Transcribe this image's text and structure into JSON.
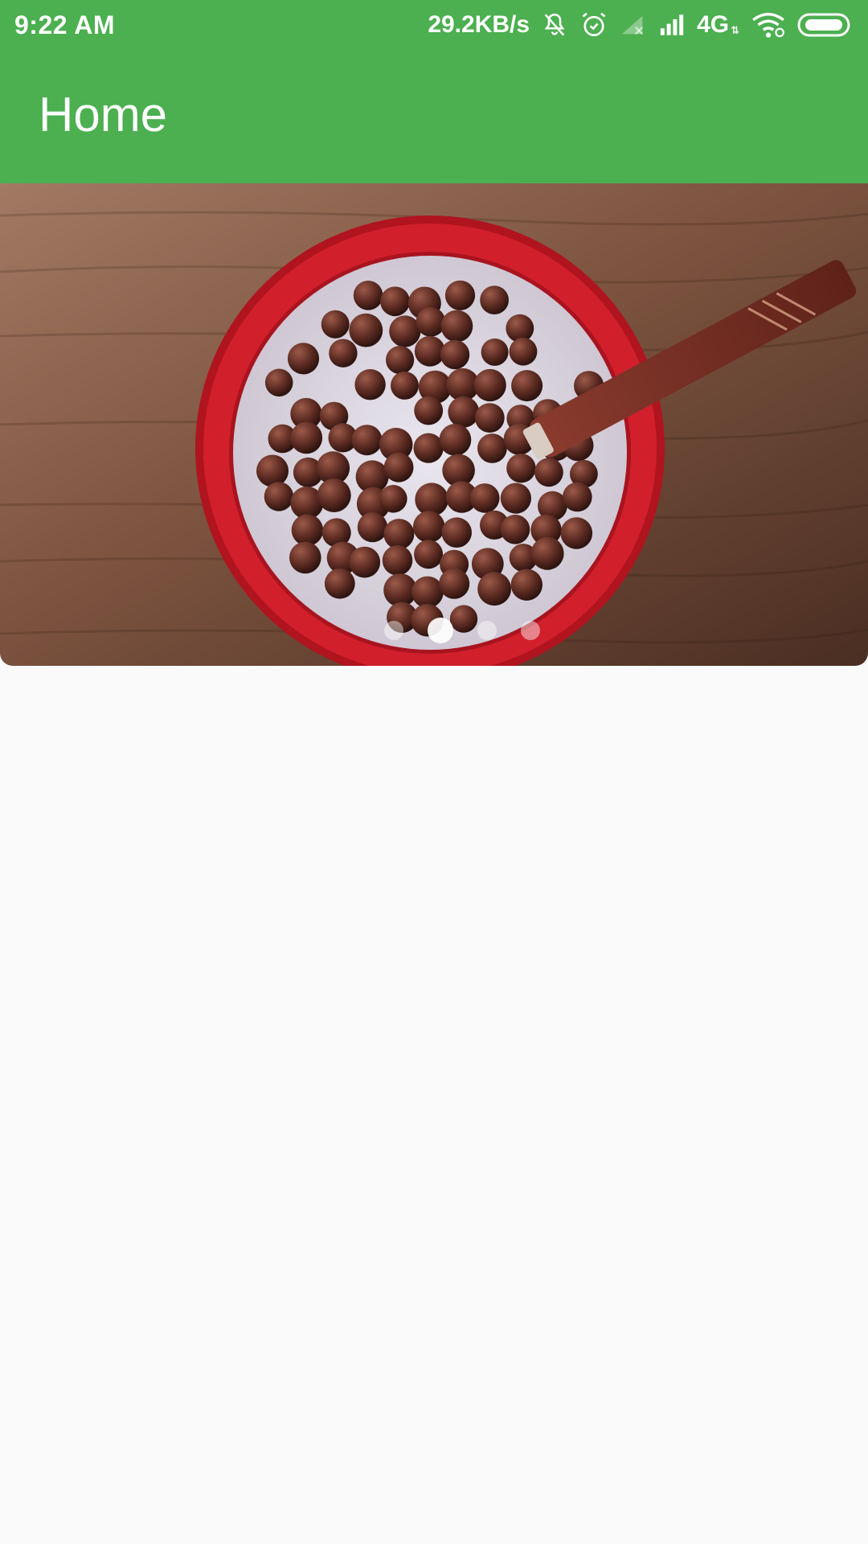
{
  "status_bar": {
    "time": "9:22 AM",
    "net_speed": "29.2KB/s",
    "network_type": "4G",
    "network_arrows": "⇅",
    "icons": [
      "mute-bell-icon",
      "alarm-icon",
      "signal-off-icon",
      "signal-icon",
      "wifi-icon",
      "battery-icon"
    ]
  },
  "app_bar": {
    "title": "Home",
    "color": "#4caf50"
  },
  "carousel": {
    "slide_count": 4,
    "active_index": 1,
    "image_subject": "bowl of chocolate cereal with milk and wooden spoon"
  },
  "colors": {
    "primary": "#4caf50",
    "background": "#fafafa",
    "bowl_red": "#d11f2c"
  }
}
